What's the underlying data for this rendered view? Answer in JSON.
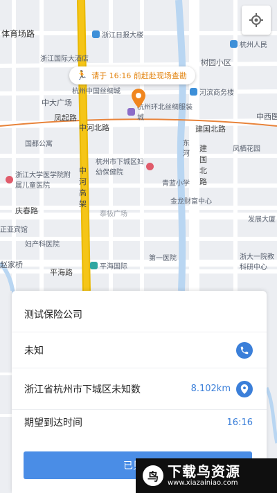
{
  "map": {
    "labels": {
      "tiyuchang_lu": "体育场路",
      "zhejiang_ribao": "浙江日报大楼",
      "zhejiang_hotel": "浙江国际大酒店",
      "hangzhou_rmyy": "杭州人民",
      "shuyuan": "树园小区",
      "silk_city": "杭州中国丝绸城",
      "zhongda_square": "中大广场",
      "huanbei": "杭州环北丝绸服装城",
      "hebin": "河滨商务楼",
      "fengqi_lu": "凤起路",
      "zhonghe_beilu": "中河北路",
      "jianguo_beilu": "建国北路",
      "zhongxi": "中西医",
      "guodu": "国都公寓",
      "fengqi_garden": "凤栖花园",
      "xiacheng_hospital": "杭州市下城区妇幼保健院",
      "donghe": "东河",
      "jianguo_vertical": "建国北路",
      "zhejiang_children": "浙江大学医学院附属儿童医院",
      "zhonghe_gaojia": "中河高架",
      "qinglan": "青蓝小学",
      "jinlong": "金龙财富中心",
      "qingchun_lu": "庆春路",
      "taiji_square": "泰极广场",
      "fazhan": "发展大厦",
      "zhengya": "正亚宾馆",
      "fuchan": "妇产科医院",
      "diyi": "第一医院",
      "zhejiang_univ": "浙大一院教科研中心",
      "zhaojia": "赵家桥",
      "pinghai_lu": "平海路",
      "pinghai_intl": "平海国际"
    }
  },
  "bubble_text": "请于 16:16 前赶赴现场查勘",
  "card": {
    "company": "测试保险公司",
    "contact": "未知",
    "address": "浙江省杭州市下城区未知数",
    "distance": "8.102km",
    "expected_label": "期望到达时间",
    "expected_time": "16:16",
    "button_label": "已见到"
  },
  "watermark": {
    "title": "下载鸟资源",
    "url": "www.xiazainiao.com"
  },
  "colors": {
    "accent": "#3b7fd9",
    "highway": "#f5c518",
    "alert": "#e2820c"
  }
}
